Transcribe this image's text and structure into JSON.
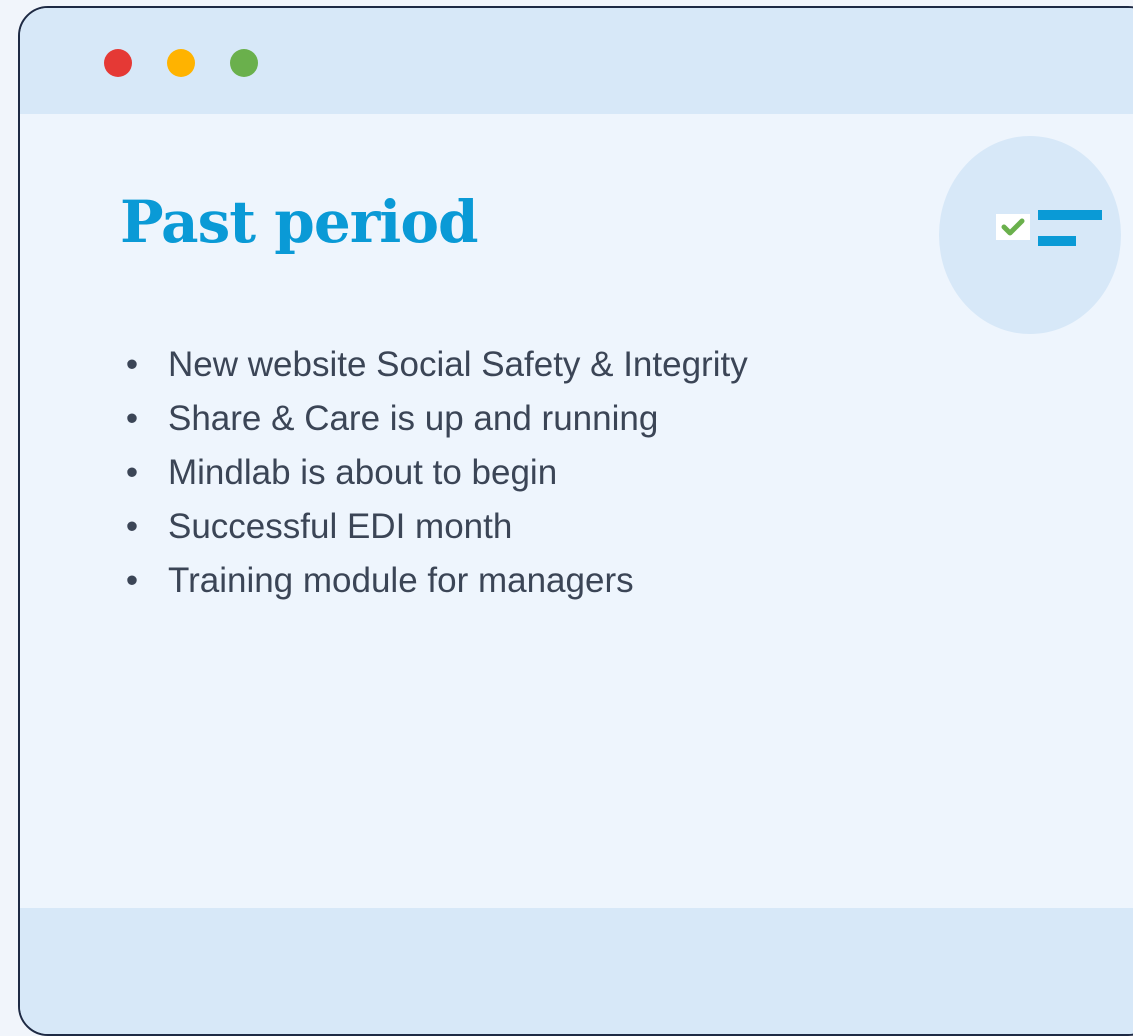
{
  "window": {
    "controls": [
      "close",
      "minimize",
      "maximize"
    ],
    "colors": {
      "close": "#e53935",
      "minimize": "#ffb300",
      "maximize": "#6ab04c"
    }
  },
  "title": "Past period",
  "badge": {
    "icon": "checklist-icon",
    "accent": "#0a9ad6",
    "check_color": "#6ab04c"
  },
  "bullet_symbol": "•",
  "items": [
    "New website Social Safety & Integrity",
    "Share & Care is up and running",
    "Mindlab is about to begin",
    "Successful EDI month",
    "Training module for managers"
  ]
}
